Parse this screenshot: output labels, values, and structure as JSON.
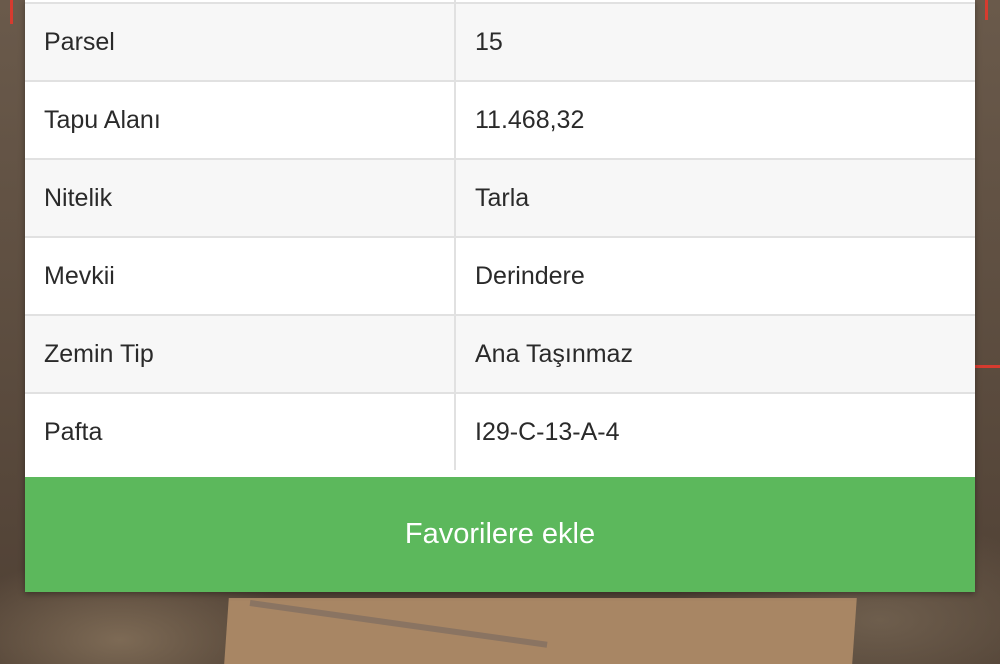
{
  "details": {
    "rows": [
      {
        "label": "Parsel",
        "value": "15"
      },
      {
        "label": "Tapu Alanı",
        "value": "11.468,32"
      },
      {
        "label": "Nitelik",
        "value": "Tarla"
      },
      {
        "label": "Mevkii",
        "value": "Derindere"
      },
      {
        "label": "Zemin Tip",
        "value": "Ana Taşınmaz"
      },
      {
        "label": "Pafta",
        "value": "I29-C-13-A-4"
      }
    ]
  },
  "actions": {
    "favorite_label": "Favorilere ekle"
  },
  "colors": {
    "button_green": "#5cb85c",
    "boundary_red": "#d63b2f"
  }
}
